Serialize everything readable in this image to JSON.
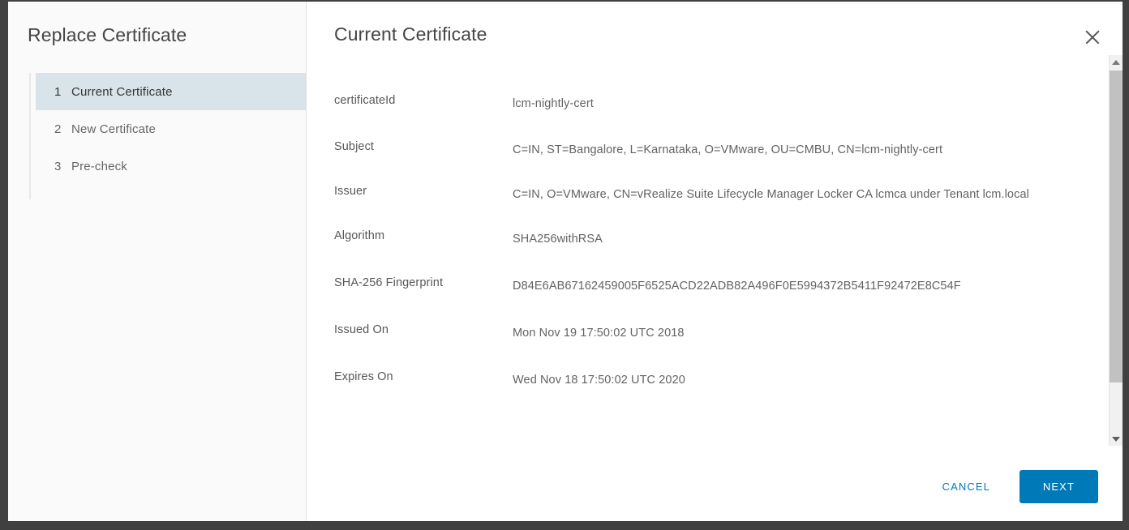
{
  "window": {
    "wizard_title": "Replace Certificate",
    "content_title": "Current Certificate",
    "close_icon": "close-icon"
  },
  "sidebar": {
    "steps": [
      {
        "num": "1",
        "label": "Current Certificate",
        "active": true
      },
      {
        "num": "2",
        "label": "New Certificate",
        "active": false
      },
      {
        "num": "3",
        "label": "Pre-check",
        "active": false
      }
    ]
  },
  "certificate": {
    "rows": [
      {
        "label": "certificateId",
        "value": "lcm-nightly-cert"
      },
      {
        "label": "Subject",
        "value": "C=IN, ST=Bangalore, L=Karnataka, O=VMware, OU=CMBU, CN=lcm-nightly-cert"
      },
      {
        "label": "Issuer",
        "value": "C=IN, O=VMware, CN=vRealize Suite Lifecycle Manager Locker CA lcmca under Tenant lcm.local"
      },
      {
        "label": "Algorithm",
        "value": "SHA256withRSA"
      },
      {
        "label": "SHA-256 Fingerprint",
        "value": "D84E6AB67162459005F6525ACD22ADB82A496F0E5994372B5411F92472E8C54F"
      },
      {
        "label": "Issued On",
        "value": "Mon Nov 19 17:50:02 UTC 2018"
      },
      {
        "label": "Expires On",
        "value": "Wed Nov 18 17:50:02 UTC 2020"
      }
    ]
  },
  "footer": {
    "cancel_label": "CANCEL",
    "next_label": "NEXT"
  },
  "scrollbar": {
    "up_icon": "chevron-up-icon",
    "down_icon": "chevron-down-icon"
  },
  "colors": {
    "accent": "#0079b8",
    "active_step_bg": "#d9e4ea",
    "sidebar_bg": "#fafafa",
    "frame": "#404040"
  }
}
